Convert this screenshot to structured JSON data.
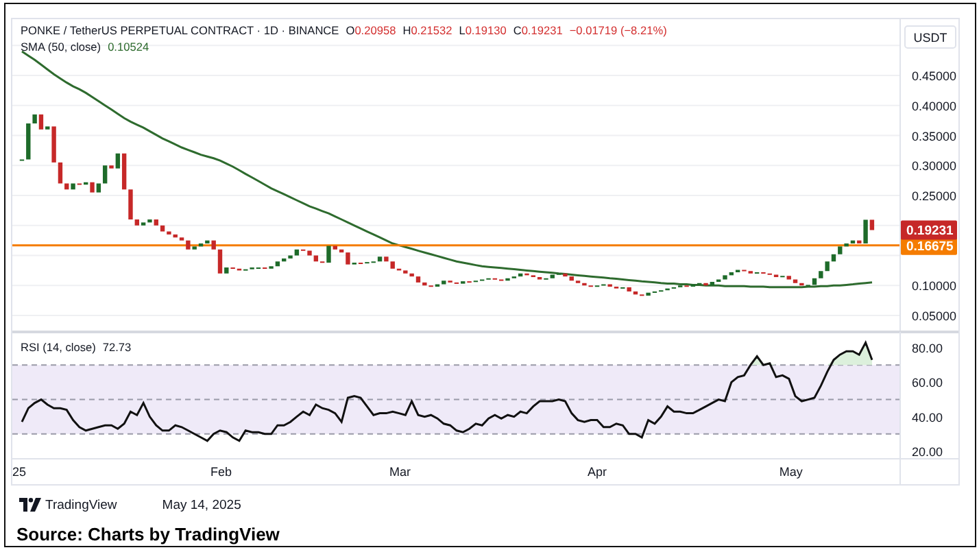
{
  "price_pane": {
    "legend": {
      "symbol": "PONKE / TetherUS PERPETUAL CONTRACT · 1D · BINANCE",
      "ohlc": [
        {
          "key": "O",
          "value": "0.20958"
        },
        {
          "key": "H",
          "value": "0.21532"
        },
        {
          "key": "L",
          "value": "0.19130"
        },
        {
          "key": "C",
          "value": "0.19231"
        }
      ],
      "change": "−0.01719 (−8.21%)"
    },
    "indicator_value": "0.10524",
    "currency_button": "USDT",
    "last_price": {
      "label": "0.19231",
      "color": "#c62828"
    },
    "chart_data": {
      "type": "line",
      "grid": true,
      "ylim": [
        0.0226,
        0.5437
      ],
      "yticks": [
        {
          "value": 0.05,
          "label": "0.05000"
        },
        {
          "value": 0.1,
          "label": "0.10000"
        },
        {
          "value": 0.25,
          "label": "0.25000"
        },
        {
          "value": 0.3,
          "label": "0.30000"
        },
        {
          "value": 0.35,
          "label": "0.35000"
        },
        {
          "value": 0.4,
          "label": "0.40000"
        },
        {
          "value": 0.45,
          "label": "0.45000"
        }
      ],
      "series": [
        {
          "name": "SMA (50, close)",
          "color": "#2e6b2e",
          "values": [
            0.49,
            0.483,
            0.476,
            0.468,
            0.46,
            0.452,
            0.445,
            0.438,
            0.432,
            0.427,
            0.421,
            0.414,
            0.407,
            0.4,
            0.393,
            0.386,
            0.379,
            0.373,
            0.368,
            0.363,
            0.357,
            0.351,
            0.345,
            0.34,
            0.335,
            0.33,
            0.326,
            0.322,
            0.318,
            0.315,
            0.312,
            0.308,
            0.303,
            0.298,
            0.292,
            0.286,
            0.28,
            0.274,
            0.268,
            0.262,
            0.257,
            0.252,
            0.247,
            0.242,
            0.237,
            0.232,
            0.228,
            0.224,
            0.22,
            0.215,
            0.21,
            0.205,
            0.2,
            0.195,
            0.19,
            0.185,
            0.18,
            0.175,
            0.17,
            0.167,
            0.164,
            0.161,
            0.158,
            0.155,
            0.152,
            0.149,
            0.146,
            0.143,
            0.14,
            0.138,
            0.136,
            0.134,
            0.132,
            0.131,
            0.13,
            0.129,
            0.128,
            0.127,
            0.126,
            0.125,
            0.124,
            0.123,
            0.122,
            0.121,
            0.12,
            0.119,
            0.118,
            0.117,
            0.116,
            0.115,
            0.114,
            0.113,
            0.112,
            0.111,
            0.11,
            0.109,
            0.108,
            0.107,
            0.106,
            0.105,
            0.104,
            0.103,
            0.103,
            0.102,
            0.102,
            0.101,
            0.101,
            0.1,
            0.1,
            0.1,
            0.099,
            0.099,
            0.099,
            0.099,
            0.098,
            0.098,
            0.098,
            0.097,
            0.097,
            0.097,
            0.097,
            0.097,
            0.097,
            0.098,
            0.098,
            0.099,
            0.099,
            0.1,
            0.1,
            0.101,
            0.102,
            0.103,
            0.104,
            0.105
          ]
        }
      ],
      "ref_lines": [
        {
          "axis": "y",
          "value": 0.16675,
          "label": "0.16675",
          "color": "#f57c00"
        }
      ]
    }
  },
  "rsi_pane": {
    "legend_value": "72.73",
    "chart_data": {
      "type": "line",
      "ylim": [
        16,
        89.2
      ],
      "categories": [
        "25",
        null,
        null,
        null,
        null,
        null,
        null,
        null,
        null,
        null,
        null,
        null,
        null,
        null,
        null,
        null,
        null,
        null,
        null,
        null,
        null,
        null,
        null,
        null,
        null,
        null,
        null,
        null,
        null,
        null,
        null,
        "Feb",
        null,
        null,
        null,
        null,
        null,
        null,
        null,
        null,
        null,
        null,
        null,
        null,
        null,
        null,
        null,
        null,
        null,
        null,
        null,
        null,
        null,
        null,
        null,
        null,
        null,
        null,
        null,
        "Mar",
        null,
        null,
        null,
        null,
        null,
        null,
        null,
        null,
        null,
        null,
        null,
        null,
        null,
        null,
        null,
        null,
        null,
        null,
        null,
        null,
        null,
        null,
        null,
        null,
        null,
        null,
        null,
        null,
        null,
        null,
        "Apr",
        null,
        null,
        null,
        null,
        null,
        null,
        null,
        null,
        null,
        null,
        null,
        null,
        null,
        null,
        null,
        null,
        null,
        null,
        null,
        null,
        null,
        null,
        null,
        null,
        null,
        null,
        null,
        null,
        null,
        "May",
        null,
        null,
        null,
        null,
        null,
        null,
        null,
        null,
        null,
        null,
        null,
        null,
        null
      ],
      "yticks": [
        {
          "value": 20,
          "label": "20.00"
        },
        {
          "value": 40,
          "label": "40.00"
        },
        {
          "value": 60,
          "label": "60.00"
        },
        {
          "value": 80,
          "label": "80.00"
        }
      ],
      "series": [
        {
          "name": "RSI (14, close)",
          "color": "#111111",
          "values": [
            37,
            45,
            48,
            50,
            47,
            45,
            45,
            44,
            38,
            34,
            32,
            33,
            34,
            35,
            35,
            33,
            36,
            43,
            41,
            48,
            40,
            35,
            32,
            32,
            35,
            34,
            32,
            30,
            28,
            26,
            30,
            32,
            31,
            28,
            26,
            32,
            31,
            31,
            30,
            30,
            35,
            35,
            37,
            40,
            43,
            41,
            47,
            45,
            44,
            42,
            37,
            51,
            52,
            51,
            46,
            41,
            42,
            42,
            43,
            42,
            41,
            49,
            41,
            40,
            41,
            39,
            36,
            35,
            32,
            31,
            33,
            36,
            35,
            39,
            41,
            39,
            41,
            40,
            43,
            42,
            46,
            49,
            49,
            49,
            50,
            49,
            42,
            38,
            37,
            38,
            38,
            34,
            34,
            36,
            35,
            30,
            30,
            28,
            38,
            36,
            40,
            46,
            43,
            43,
            42,
            42,
            44,
            46,
            48,
            50,
            49,
            60,
            63,
            64,
            70,
            75,
            70,
            71,
            63,
            64,
            62,
            52,
            49,
            50,
            51,
            58,
            66,
            73,
            76,
            78,
            78,
            76,
            83,
            73
          ]
        }
      ],
      "bands": [
        {
          "axis": "y",
          "from": 30,
          "to": 70,
          "color": "#efeaf8"
        }
      ],
      "ref_lines": [
        {
          "axis": "y",
          "value": 70,
          "color": "#9a9aa8"
        },
        {
          "axis": "y",
          "value": 50,
          "color": "#9a9aa8"
        },
        {
          "axis": "y",
          "value": 30,
          "color": "#9a9aa8"
        }
      ]
    }
  },
  "footer": {
    "brand": "TradingView",
    "date": "May 14, 2025"
  },
  "source": "Source: Charts by TradingView"
}
